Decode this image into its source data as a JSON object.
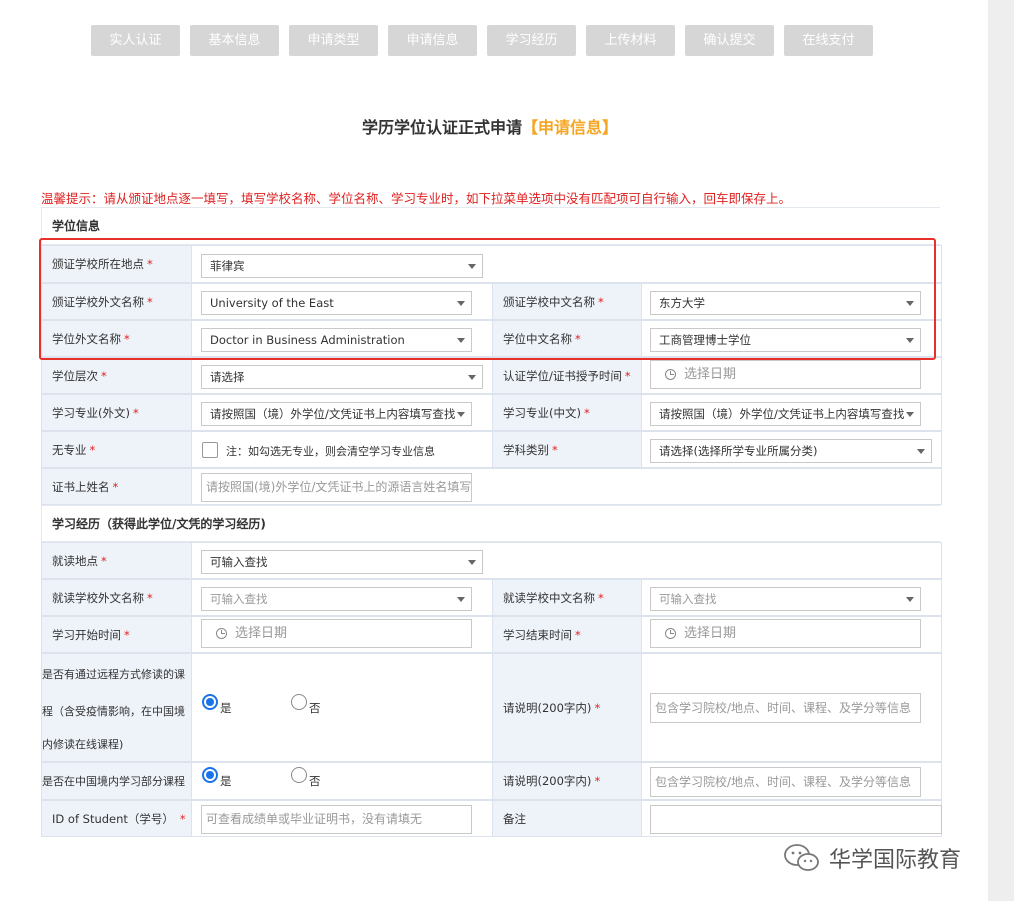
{
  "steps": [
    "实人认证",
    "基本信息",
    "申请类型",
    "申请信息",
    "学习经历",
    "上传材料",
    "确认提交",
    "在线支付"
  ],
  "title": "学历学位认证正式申请",
  "title_sub": "【申请信息】",
  "warning": "温馨提示：请从颁证地点逐一填写，填写学校名称、学位名称、学习专业时，如下拉菜单选项中没有匹配项可自行输入，回车即保存上。",
  "degree_section": {
    "header": "学位信息",
    "issuing_location": {
      "label": "颁证学校所在地点",
      "value": "菲律宾"
    },
    "school_foreign": {
      "label": "颁证学校外文名称",
      "value": "University of the East"
    },
    "school_chinese": {
      "label": "颁证学校中文名称",
      "value": "东方大学"
    },
    "degree_foreign": {
      "label": "学位外文名称",
      "value": "Doctor in Business Administration"
    },
    "degree_chinese": {
      "label": "学位中文名称",
      "value": "工商管理博士学位"
    },
    "degree_level": {
      "label": "学位层次",
      "value": "请选择"
    },
    "grant_time": {
      "label": "认证学位/证书授予时间",
      "placeholder": "选择日期"
    },
    "major_foreign": {
      "label": "学习专业(外文)",
      "value": "请按照国（境）外学位/文凭证书上内容填写查找"
    },
    "major_chinese": {
      "label": "学习专业(中文)",
      "value": "请按照国（境）外学位/文凭证书上内容填写查找"
    },
    "no_major": {
      "label": "无专业",
      "note": "注：如勾选无专业，则会清空学习专业信息"
    },
    "discipline": {
      "label": "学科类别",
      "value": "请选择(选择所学专业所属分类)"
    },
    "cert_name": {
      "label": "证书上姓名",
      "placeholder": "请按照国(境)外学位/文凭证书上的源语言姓名填写"
    }
  },
  "study_section": {
    "header": "学习经历（获得此学位/文凭的学习经历)",
    "study_location": {
      "label": "就读地点",
      "value": "可输入查找"
    },
    "study_school_foreign": {
      "label": "就读学校外文名称",
      "placeholder": "可输入查找"
    },
    "study_school_chinese": {
      "label": "就读学校中文名称",
      "placeholder": "可输入查找"
    },
    "start_time": {
      "label": "学习开始时间",
      "placeholder": "选择日期"
    },
    "end_time": {
      "label": "学习结束时间",
      "placeholder": "选择日期"
    },
    "remote": {
      "label_lines": [
        "是否有通过远程方式修读的课",
        "程（含受疫情影响，在中国境",
        "内修读在线课程)"
      ],
      "yes": "是",
      "no": "否",
      "explain_label": "请说明(200字内)",
      "explain_placeholder": "包含学习院校/地点、时间、课程、及学分等信息"
    },
    "china_part": {
      "label": "是否在中国境内学习部分课程",
      "yes": "是",
      "no": "否",
      "explain_label": "请说明(200字内)",
      "explain_placeholder": "包含学习院校/地点、时间、课程、及学分等信息"
    },
    "student_id": {
      "label": "ID of Student（学号）",
      "placeholder": "可查看成绩单或毕业证明书，没有请填无"
    },
    "remark": {
      "label": "备注"
    }
  },
  "required_mark": "*",
  "watermark": "华学国际教育"
}
